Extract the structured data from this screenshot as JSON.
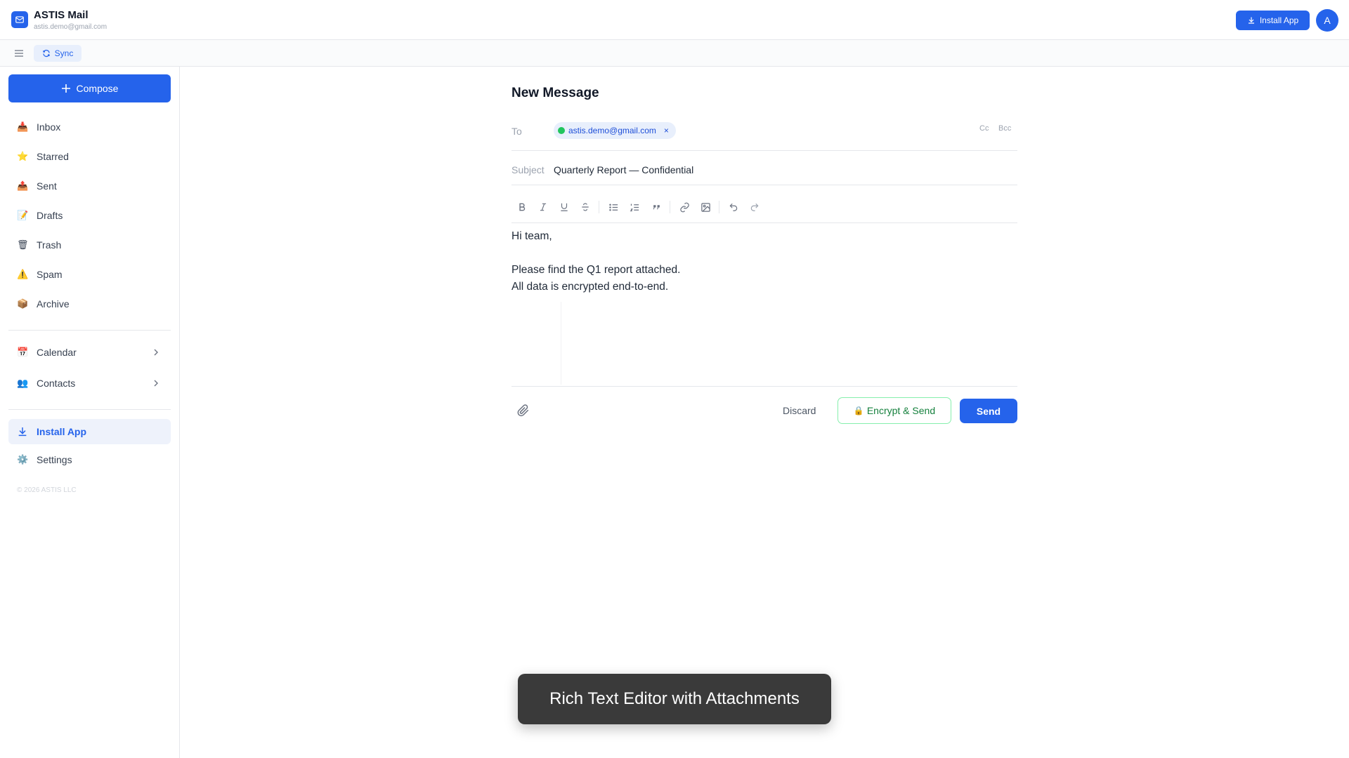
{
  "app": {
    "title": "ASTIS Mail",
    "account_email": "astis.demo@gmail.com",
    "install_label": "Install App",
    "avatar_initial": "A",
    "accent_color": "#2563eb"
  },
  "toolbar": {
    "sync_label": "Sync"
  },
  "sidebar": {
    "compose_label": "Compose",
    "items": [
      {
        "label": "Inbox",
        "icon": "inbox-tray-icon"
      },
      {
        "label": "Starred",
        "icon": "star-icon"
      },
      {
        "label": "Sent",
        "icon": "outbox-tray-icon"
      },
      {
        "label": "Drafts",
        "icon": "memo-icon"
      },
      {
        "label": "Trash",
        "icon": "wastebasket-icon"
      },
      {
        "label": "Spam",
        "icon": "warning-icon"
      },
      {
        "label": "Archive",
        "icon": "package-icon"
      }
    ],
    "apps": [
      {
        "label": "Calendar",
        "icon": "calendar-icon"
      },
      {
        "label": "Contacts",
        "icon": "people-icon"
      }
    ],
    "install_label": "Install App",
    "settings_label": "Settings",
    "copyright": "© 2026 ASTIS LLC"
  },
  "composer": {
    "title": "New Message",
    "to_label": "To",
    "recipient": "astis.demo@gmail.com",
    "recipient_remove": "×",
    "cc_label": "Cc",
    "bcc_label": "Bcc",
    "subject_label": "Subject",
    "subject_value": "Quarterly Report — Confidential",
    "body_lines": [
      "Hi team,",
      "Please find the Q1 report attached.",
      "All data is encrypted end-to-end."
    ],
    "discard_label": "Discard",
    "encrypt_send_label": "Encrypt & Send",
    "send_label": "Send"
  },
  "toast": {
    "text": "Rich Text Editor with Attachments"
  }
}
